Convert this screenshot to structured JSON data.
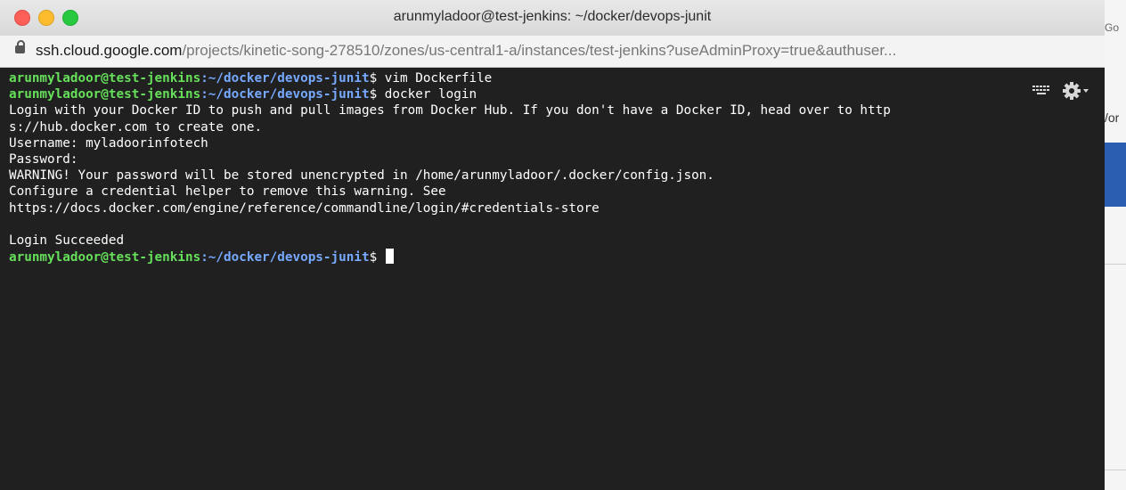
{
  "window": {
    "title": "arunmyladoor@test-jenkins: ~/docker/devops-junit"
  },
  "urlbar": {
    "host": "ssh.cloud.google.com",
    "path": "/projects/kinetic-song-278510/zones/us-central1-a/instances/test-jenkins?useAdminProxy=true&authuser..."
  },
  "terminal": {
    "prompt_user": "arunmyladoor@test-jenkins",
    "prompt_path": ":~/docker/devops-junit",
    "prompt_symbol": "$ ",
    "lines": [
      {
        "type": "cmd",
        "text": "vim Dockerfile"
      },
      {
        "type": "cmd",
        "text": "docker login"
      },
      {
        "type": "out",
        "text": "Login with your Docker ID to push and pull images from Docker Hub. If you don't have a Docker ID, head over to http"
      },
      {
        "type": "out",
        "text": "s://hub.docker.com to create one."
      },
      {
        "type": "out",
        "text": "Username: myladoorinfotech"
      },
      {
        "type": "out",
        "text": "Password:"
      },
      {
        "type": "out",
        "text": "WARNING! Your password will be stored unencrypted in /home/arunmyladoor/.docker/config.json."
      },
      {
        "type": "out",
        "text": "Configure a credential helper to remove this warning. See"
      },
      {
        "type": "out",
        "text": "https://docs.docker.com/engine/reference/commandline/login/#credentials-store"
      },
      {
        "type": "out",
        "text": ""
      },
      {
        "type": "out",
        "text": "Login Succeeded"
      },
      {
        "type": "cmd",
        "text": "",
        "cursor": true
      }
    ],
    "icons": [
      "keyboard-icon",
      "gear-icon"
    ]
  },
  "background": {
    "snippet_top": "Go",
    "snippet_mid": "/or"
  },
  "colors": {
    "prompt_user": "#66e05a",
    "prompt_path": "#76a9ff",
    "terminal_bg": "#202020"
  }
}
